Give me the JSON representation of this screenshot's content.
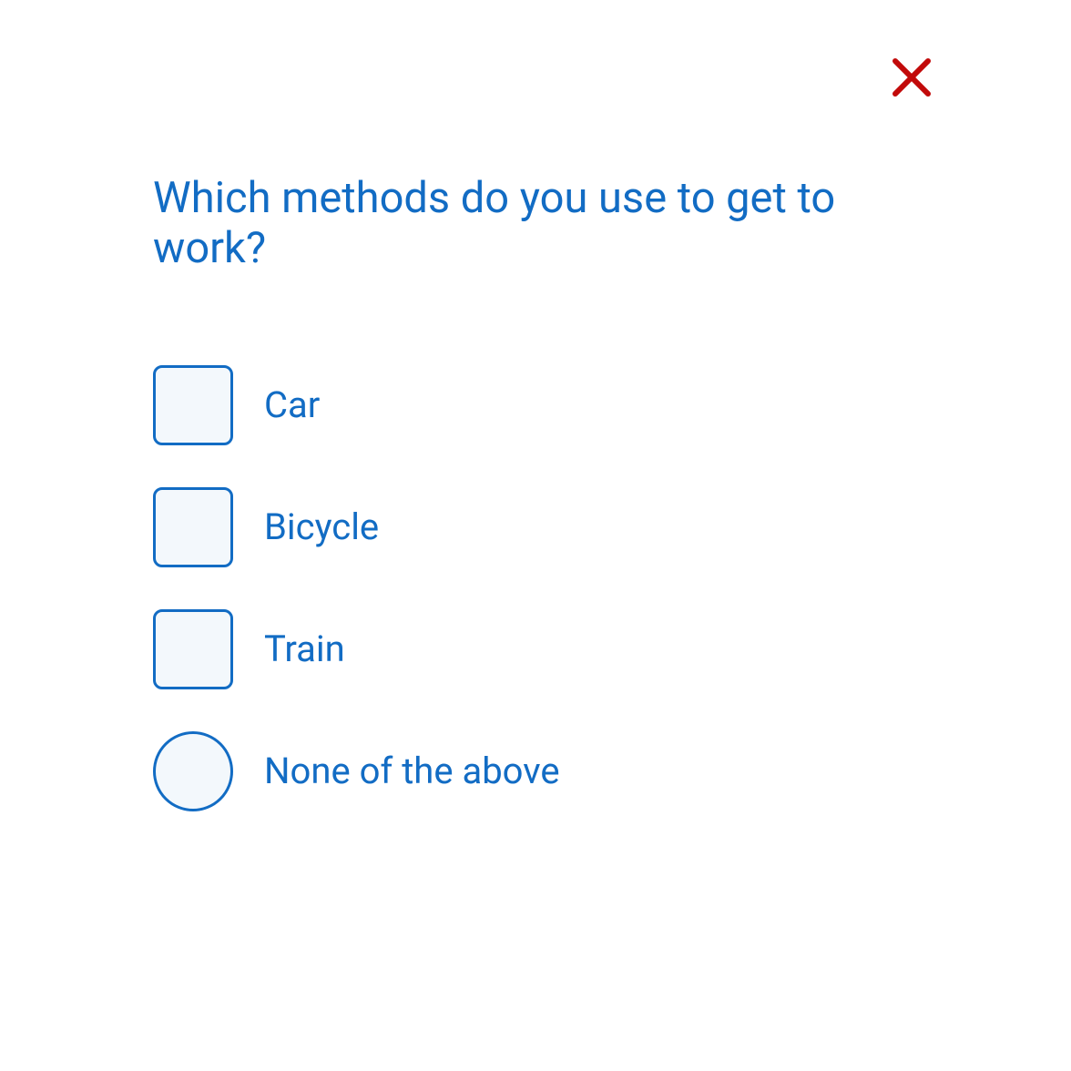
{
  "question": "Which methods do you use to get to work?",
  "options": [
    {
      "label": "Car",
      "type": "checkbox"
    },
    {
      "label": "Bicycle",
      "type": "checkbox"
    },
    {
      "label": "Train",
      "type": "checkbox"
    },
    {
      "label": "None of the above",
      "type": "radio"
    }
  ],
  "colors": {
    "primary": "#126cc4",
    "close": "#c20a0a",
    "checkboxBg": "#f3f8fc"
  }
}
